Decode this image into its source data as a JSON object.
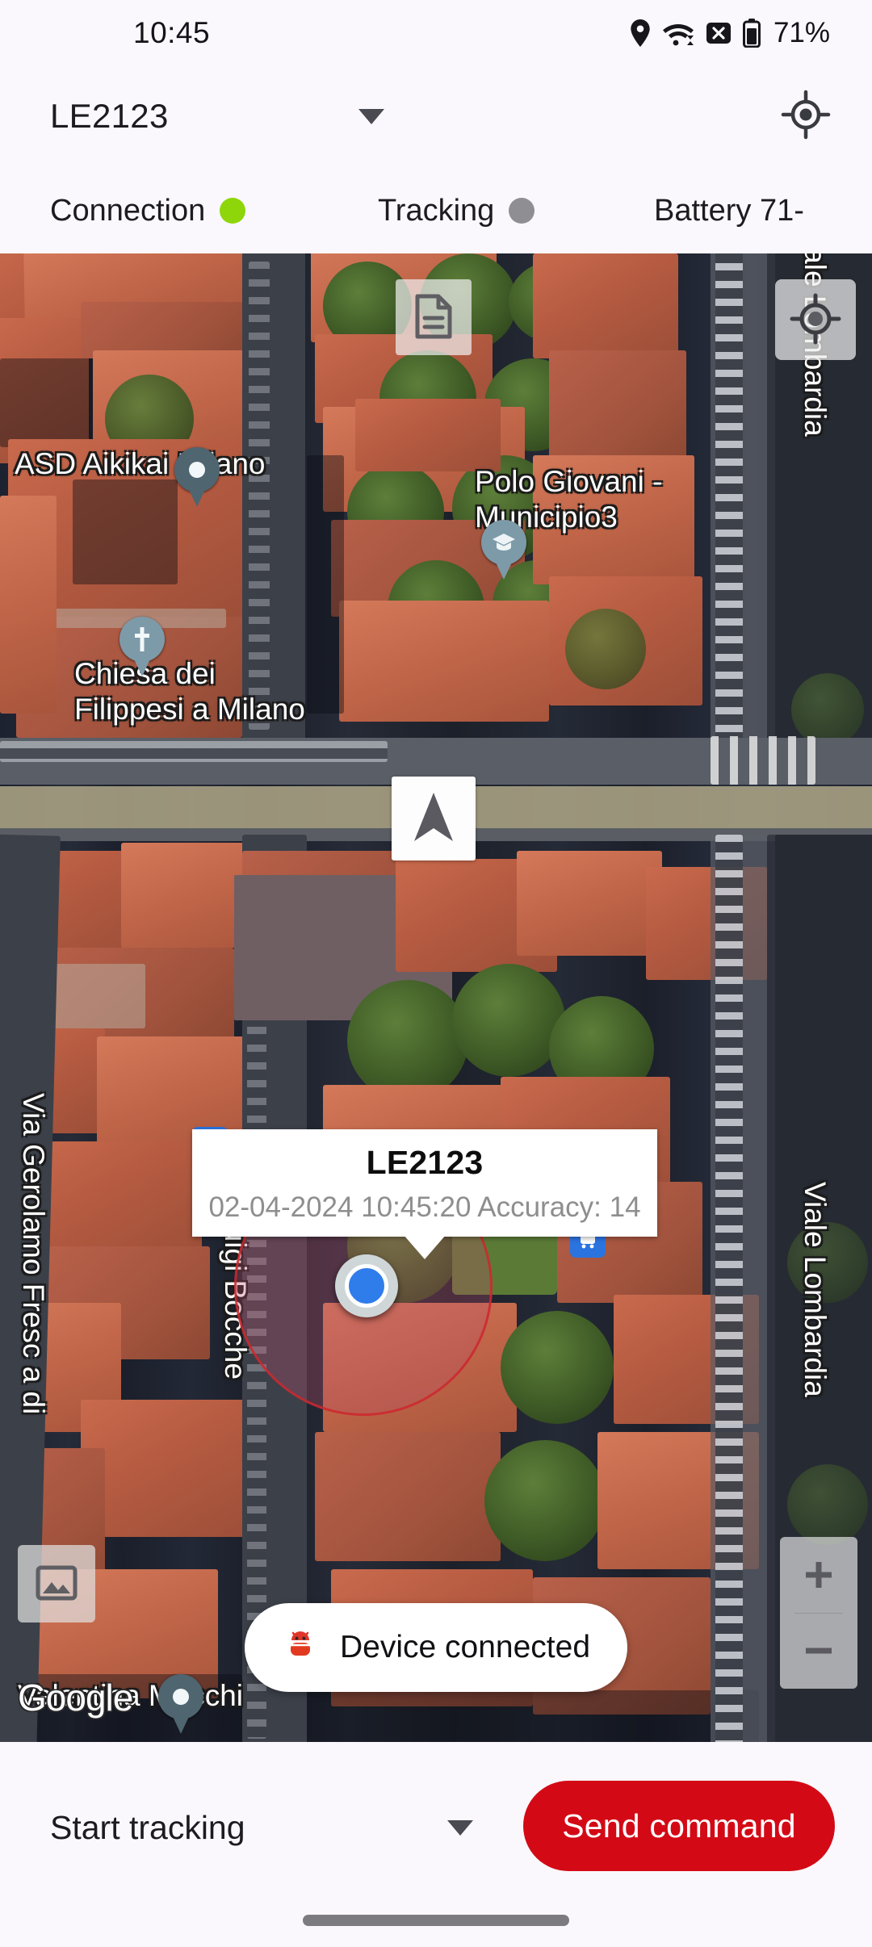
{
  "status_bar": {
    "time": "10:45",
    "battery_percent": "71%",
    "icons": [
      "location-pin-icon",
      "wifi-icon",
      "no-sim-icon",
      "battery-icon"
    ]
  },
  "app_header": {
    "device_name": "LE2123",
    "dropdown_icon": "chevron-down-icon",
    "locate_icon": "my-location-icon"
  },
  "status_row": {
    "connection": {
      "label": "Connection",
      "color": "#8ed60a",
      "state": "on"
    },
    "tracking": {
      "label": "Tracking",
      "color": "#8f8f93",
      "state": "off"
    },
    "battery": {
      "label": "Battery  71-"
    }
  },
  "map": {
    "provider_watermark": "Google",
    "controls": {
      "document_button": "document-icon",
      "my_location_button": "my-location-icon",
      "compass_button": "navigation-arrow-icon",
      "layers_button": "map-layers-icon",
      "zoom_in": "+",
      "zoom_out": "–"
    },
    "info_window": {
      "title": "LE2123",
      "subtitle": "02-04-2024 10:45:20 Accuracy: 14"
    },
    "pois": [
      {
        "label": "ASD Aikikai Milano",
        "icon": "generic-place-pin"
      },
      {
        "label": "Polo Giovani -\nMunicipio3",
        "icon": "school-pin"
      },
      {
        "label": "Chiesa dei\nFilippesi a Milano",
        "icon": "church-pin"
      },
      {
        "label": "Valentina Mocchi",
        "icon": "generic-place-pin"
      }
    ],
    "poi_labels": {
      "aikikai": "ASD Aikikai Milano",
      "polo_line1": "Polo Giovani -",
      "polo_line2": "Municipio3",
      "chiesa_line1": "Chiesa dei",
      "chiesa_line2": "Filippesi a Milano",
      "valentina": "Valentina Mocchi"
    },
    "streets": {
      "lombardia_top": "Viale Lombardia",
      "lombardia_bottom": "Viale Lombardia",
      "frescobaldi": "Via Gerolamo Fresc   a di",
      "boccherini": "Via Luigi Bocche"
    }
  },
  "snackbar": {
    "text": "Device connected",
    "icon": "android-robot-icon"
  },
  "bottom_bar": {
    "command_label": "Start tracking",
    "command_dropdown_icon": "chevron-down-icon",
    "send_button": "Send command",
    "send_button_color": "#d30a16"
  }
}
